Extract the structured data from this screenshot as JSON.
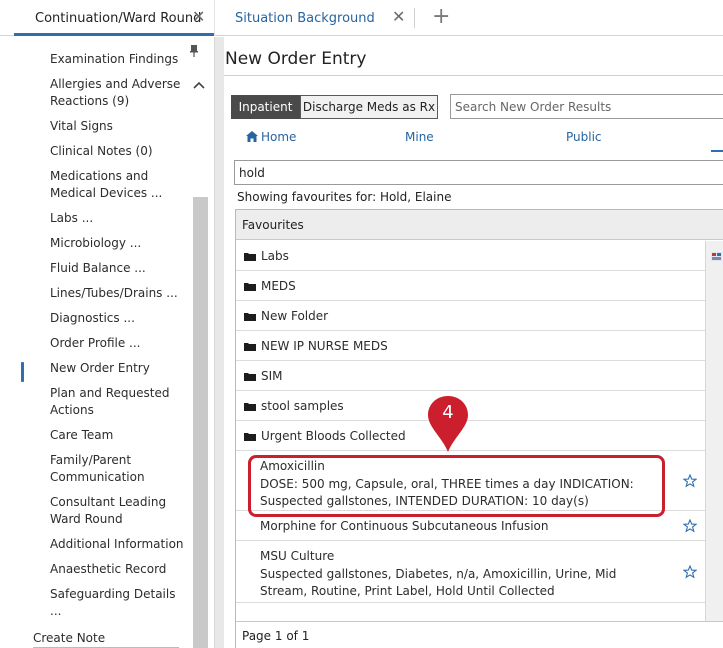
{
  "tabs": [
    {
      "label": "Continuation/Ward Round"
    },
    {
      "label": "Situation Background"
    }
  ],
  "nav": {
    "items": [
      {
        "label": "Examination Findings"
      },
      {
        "label": "Allergies and Adverse Reactions (9)"
      },
      {
        "label": "Vital Signs"
      },
      {
        "label": "Clinical Notes (0)"
      },
      {
        "label": "Medications and Medical Devices ..."
      },
      {
        "label": "Labs ..."
      },
      {
        "label": "Microbiology ..."
      },
      {
        "label": "Fluid Balance ..."
      },
      {
        "label": "Lines/Tubes/Drains ..."
      },
      {
        "label": "Diagnostics ..."
      },
      {
        "label": "Order Profile ..."
      },
      {
        "label": "New Order Entry"
      },
      {
        "label": "Plan and Requested Actions"
      },
      {
        "label": "Care Team"
      },
      {
        "label": "Family/Parent Communication"
      },
      {
        "label": "Consultant Leading Ward Round"
      },
      {
        "label": "Additional Information"
      },
      {
        "label": "Anaesthetic Record"
      },
      {
        "label": "Safeguarding Details ..."
      }
    ],
    "create_note": "Create Note"
  },
  "main": {
    "title": "New Order Entry",
    "toggle": {
      "inpatient": "Inpatient",
      "discharge": "Discharge Meds as Rx"
    },
    "search": {
      "placeholder": "Search New Order Results"
    },
    "subtabs": {
      "home": "Home",
      "mine": "Mine",
      "public": "Public"
    },
    "filter_value": "hold",
    "showing": "Showing favourites for: Hold, Elaine",
    "favourites_header": "Favourites",
    "folders": [
      "Labs",
      "MEDS",
      "New Folder",
      "NEW IP NURSE MEDS",
      "SIM",
      "stool samples",
      "Urgent Bloods Collected"
    ],
    "orders": [
      {
        "name": "Amoxicillin",
        "detail": "DOSE: 500 mg, Capsule, oral, THREE times a day INDICATION: Suspected gallstones, INTENDED DURATION: 10 day(s)"
      },
      {
        "name": "Morphine for Continuous Subcutaneous Infusion",
        "detail": ""
      },
      {
        "name": "MSU Culture",
        "detail": "Suspected gallstones, Diabetes, n/a, Amoxicillin, Urine, Mid Stream, Routine, Print Label, Hold Until Collected"
      }
    ],
    "pager": "Page 1 of 1"
  },
  "callout": {
    "step": "4",
    "color": "#cc1f2e"
  },
  "colors": {
    "accent": "#2f6fb0",
    "toggle_active": "#4a4a4a"
  },
  "icons": [
    "pin-icon",
    "chevron-up-icon",
    "close-icon",
    "plus-icon",
    "home-icon",
    "folder-icon",
    "star-icon",
    "flag-icon"
  ]
}
